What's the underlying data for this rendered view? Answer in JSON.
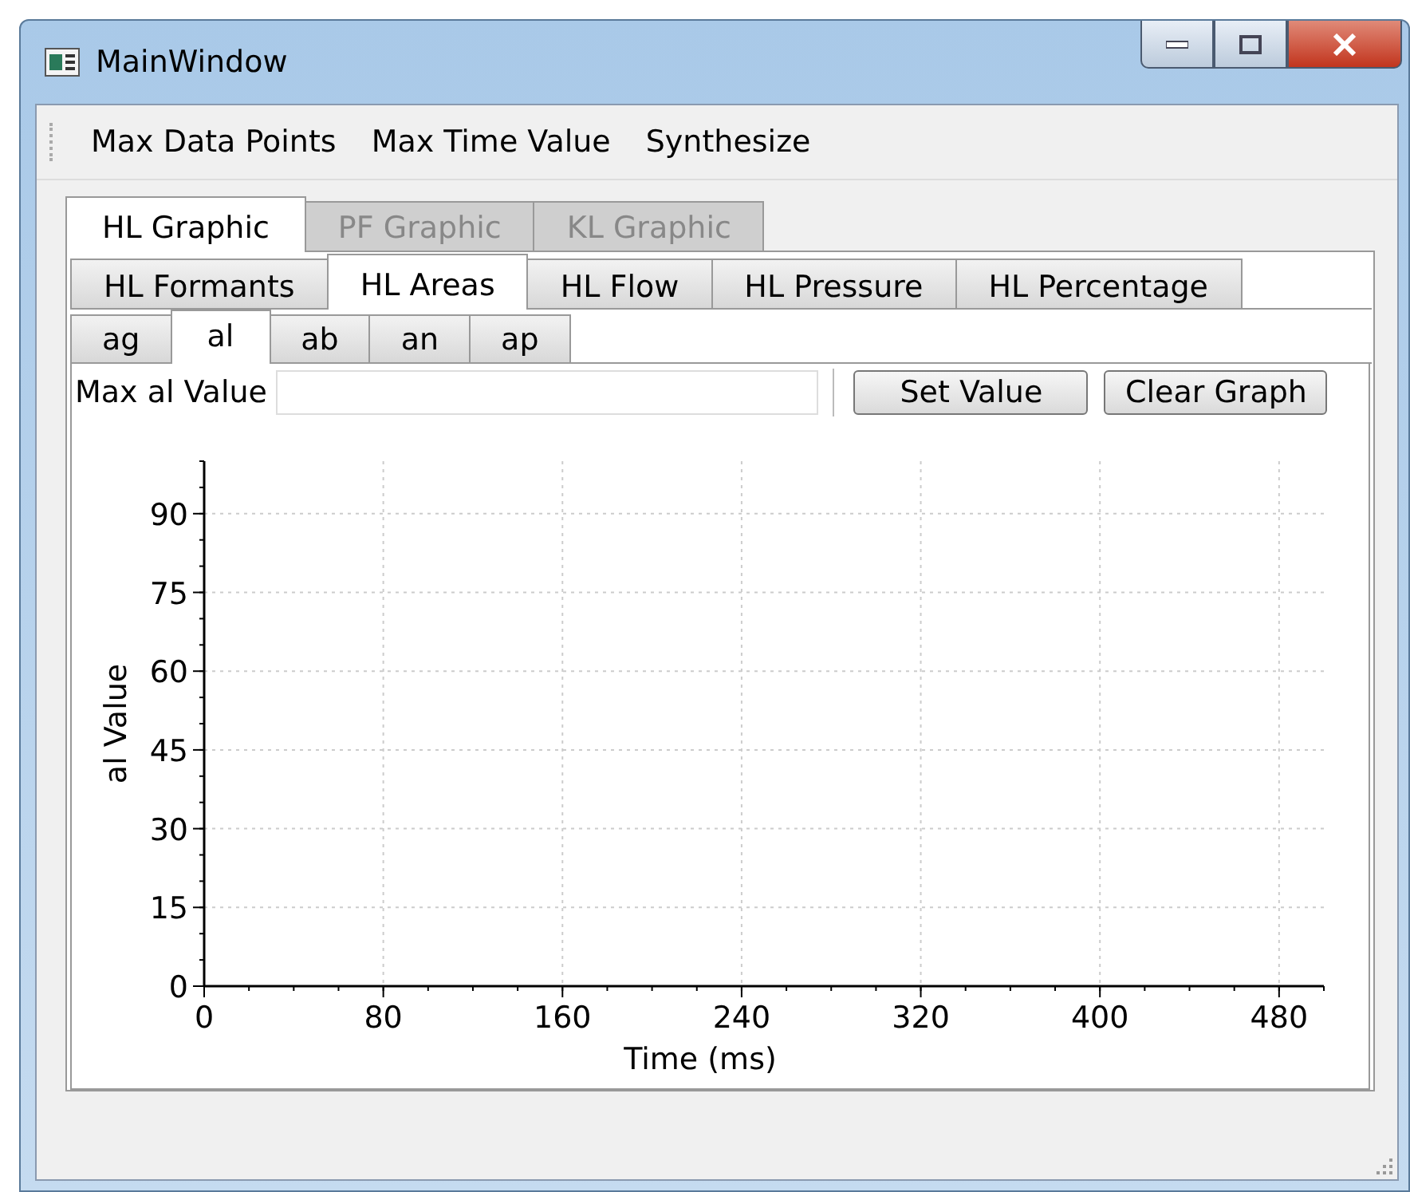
{
  "window": {
    "title": "MainWindow"
  },
  "menu": [
    "Max Data Points",
    "Max Time Value",
    "Synthesize"
  ],
  "tabs": [
    {
      "label": "HL Graphic",
      "selected": true,
      "disabled": false
    },
    {
      "label": "PF Graphic",
      "selected": false,
      "disabled": true
    },
    {
      "label": "KL Graphic",
      "selected": false,
      "disabled": true
    }
  ],
  "subtabs": [
    {
      "label": "HL Formants",
      "selected": false
    },
    {
      "label": "HL Areas",
      "selected": true
    },
    {
      "label": "HL Flow",
      "selected": false
    },
    {
      "label": "HL Pressure",
      "selected": false
    },
    {
      "label": "HL Percentage",
      "selected": false
    }
  ],
  "area_tabs": [
    {
      "label": "ag",
      "selected": false
    },
    {
      "label": "al",
      "selected": true
    },
    {
      "label": "ab",
      "selected": false
    },
    {
      "label": "an",
      "selected": false
    },
    {
      "label": "ap",
      "selected": false
    }
  ],
  "max_field": {
    "label": "Max al Value"
  },
  "buttons": [
    "Set Value",
    "Clear Graph"
  ],
  "chart": {
    "chart_data": {
      "type": "line",
      "xlabel": "Time (ms)",
      "ylabel": "al Value",
      "xlim": [
        0,
        500
      ],
      "ylim": [
        0,
        100
      ],
      "xticks": [
        0,
        80,
        160,
        240,
        320,
        400,
        480
      ],
      "yticks": [
        0,
        15,
        30,
        45,
        60,
        75,
        90
      ],
      "grid": true
    }
  }
}
